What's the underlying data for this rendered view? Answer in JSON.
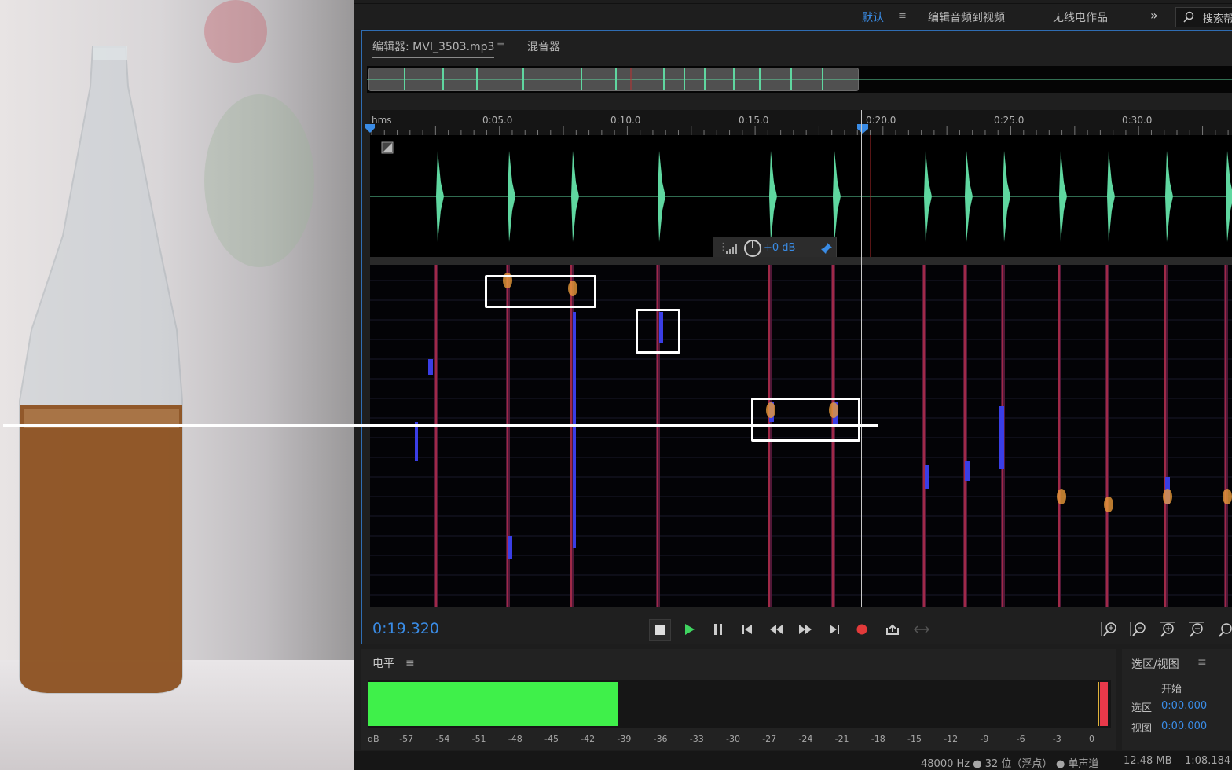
{
  "workspace": {
    "items": [
      "默认",
      "编辑音频到视频",
      "无线电作品"
    ],
    "more_icon": "chevron-double-right-icon",
    "search_placeholder": "搜索帮"
  },
  "editor": {
    "tab_editor": "编辑器: MVI_3503.mp3",
    "tab_mixer": "混音器",
    "ruler_unit": "hms",
    "ruler_ticks": [
      "0:05.0",
      "0:10.0",
      "0:15.0",
      "0:20.0",
      "0:25.0",
      "0:30.0"
    ],
    "gain_value": "+0 dB",
    "timecode": "0:19.320"
  },
  "transport": [
    "stop",
    "play",
    "pause",
    "go-to-start",
    "rewind",
    "fast-forward",
    "go-to-end",
    "record",
    "loop",
    "skip"
  ],
  "level": {
    "title": "电平",
    "fill_fraction": 0.336,
    "scale": [
      "dB",
      "-57",
      "-54",
      "-51",
      "-48",
      "-45",
      "-42",
      "-39",
      "-36",
      "-33",
      "-30",
      "-27",
      "-24",
      "-21",
      "-18",
      "-15",
      "-12",
      "-9",
      "-6",
      "-3",
      "0"
    ]
  },
  "selection_view": {
    "title": "选区/视图",
    "col_start": "开始",
    "row_selection": "选区",
    "row_view": "视图",
    "selection_start": "0:00.000",
    "view_start": "0:00.000"
  },
  "status": {
    "sample_info": "48000 Hz ● 32 位（浮点）",
    "channel": "● 单声道",
    "size": "12.48 MB",
    "duration": "1:08.184"
  },
  "colors": {
    "accent": "#3a8ce6",
    "waveform": "#5fd7a0",
    "meter": "#3ff04a",
    "peak": "#e8394a"
  }
}
